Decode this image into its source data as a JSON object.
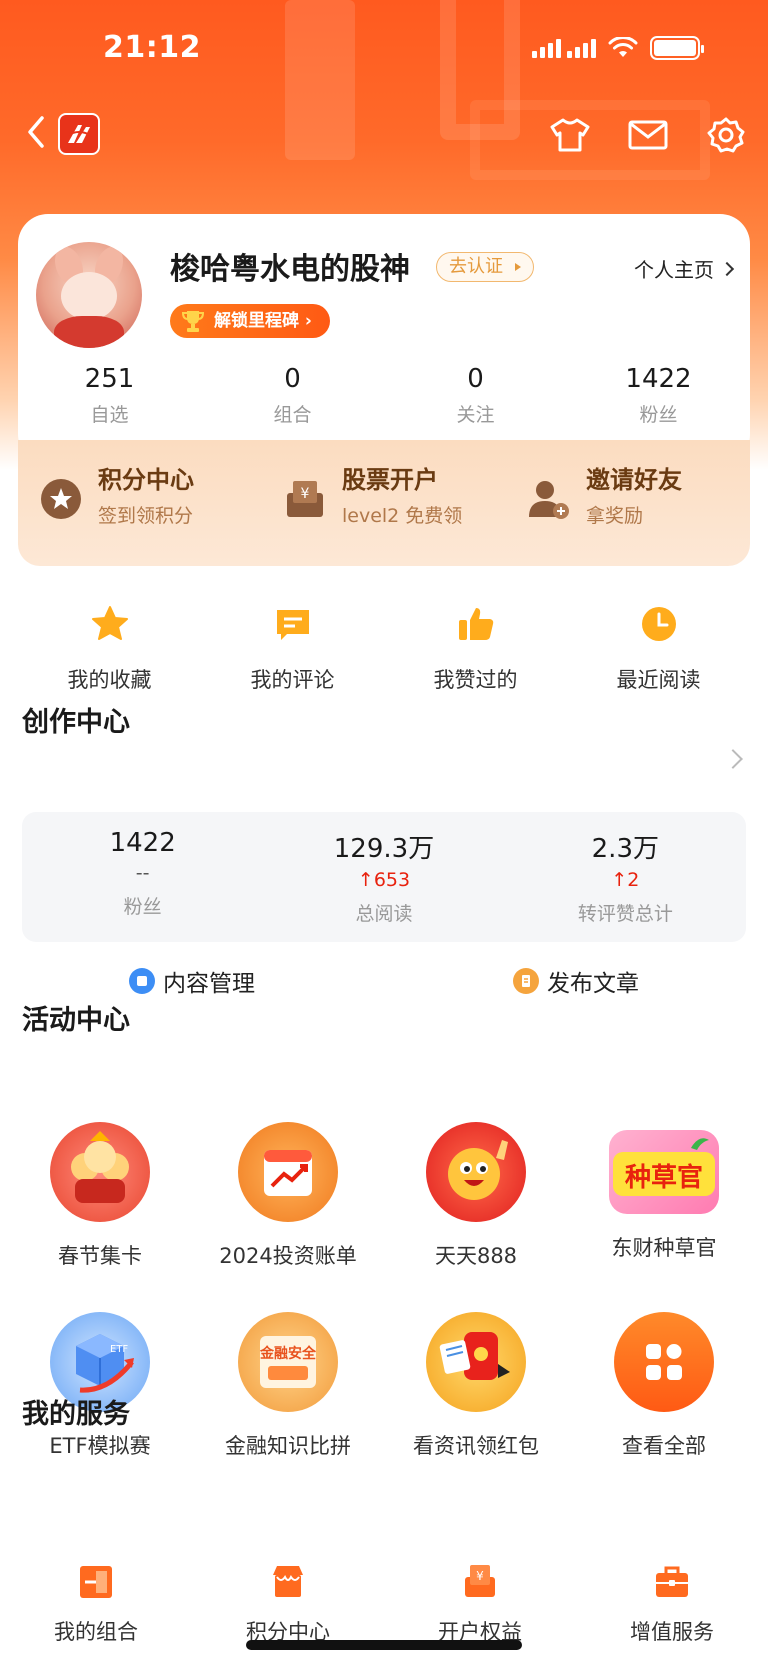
{
  "status_bar": {
    "time": "21:12"
  },
  "nav": {
    "back_icon": "back-icon",
    "logo_icon": "app-logo",
    "right_icons": [
      "shirt-icon",
      "mail-icon",
      "gear-icon"
    ]
  },
  "profile": {
    "username": "梭哈粤水电的股神",
    "verify_label": "去认证",
    "homepage_label": "个人主页",
    "milestone_label": "解锁里程碑",
    "stats": [
      {
        "value": "251",
        "label": "自选"
      },
      {
        "value": "0",
        "label": "组合"
      },
      {
        "value": "0",
        "label": "关注"
      },
      {
        "value": "1422",
        "label": "粉丝"
      }
    ]
  },
  "promo": [
    {
      "title": "积分中心",
      "subtitle": "签到领积分",
      "icon": "star-coin-icon"
    },
    {
      "title": "股票开户",
      "subtitle": "level2 免费领",
      "icon": "yen-box-icon"
    },
    {
      "title": "邀请好友",
      "subtitle": "拿奖励",
      "icon": "user-add-icon"
    }
  ],
  "quick": [
    {
      "label": "我的收藏",
      "icon": "star-icon"
    },
    {
      "label": "我的评论",
      "icon": "comment-icon"
    },
    {
      "label": "我赞过的",
      "icon": "thumb-up-icon"
    },
    {
      "label": "最近阅读",
      "icon": "clock-icon"
    }
  ],
  "creator": {
    "title": "创作中心",
    "stats": [
      {
        "value": "1422",
        "delta": "--",
        "label": "粉丝"
      },
      {
        "value": "129.3万",
        "delta": "653",
        "label": "总阅读"
      },
      {
        "value": "2.3万",
        "delta": "2",
        "label": "转评赞总计"
      }
    ],
    "actions": [
      {
        "label": "内容管理",
        "color": "#3d8ef5"
      },
      {
        "label": "发布文章",
        "color": "#f5a43d"
      }
    ]
  },
  "activity": {
    "title": "活动中心",
    "items": [
      {
        "label": "春节集卡",
        "icon": "spring-festival-card-icon"
      },
      {
        "label": "2024投资账单",
        "icon": "investment-bill-icon"
      },
      {
        "label": "天天888",
        "icon": "daily-888-icon"
      },
      {
        "label": "东财种草官",
        "icon": "seed-officer-icon",
        "art_text": "种草官"
      },
      {
        "label": "ETF模拟赛",
        "icon": "etf-cube-icon"
      },
      {
        "label": "金融知识比拼",
        "icon": "finance-quiz-icon",
        "art_text": "金融安全"
      },
      {
        "label": "看资讯领红包",
        "icon": "red-envelope-icon"
      },
      {
        "label": "查看全部",
        "icon": "grid-all-icon"
      }
    ]
  },
  "services": {
    "title": "我的服务",
    "items": [
      {
        "label": "我的组合",
        "icon": "portfolio-icon"
      },
      {
        "label": "积分中心",
        "icon": "shop-icon"
      },
      {
        "label": "开户权益",
        "icon": "yen-gift-icon"
      },
      {
        "label": "增值服务",
        "icon": "briefcase-icon"
      }
    ]
  },
  "colors": {
    "brand": "#ff5a1f",
    "up": "#e8220e"
  }
}
